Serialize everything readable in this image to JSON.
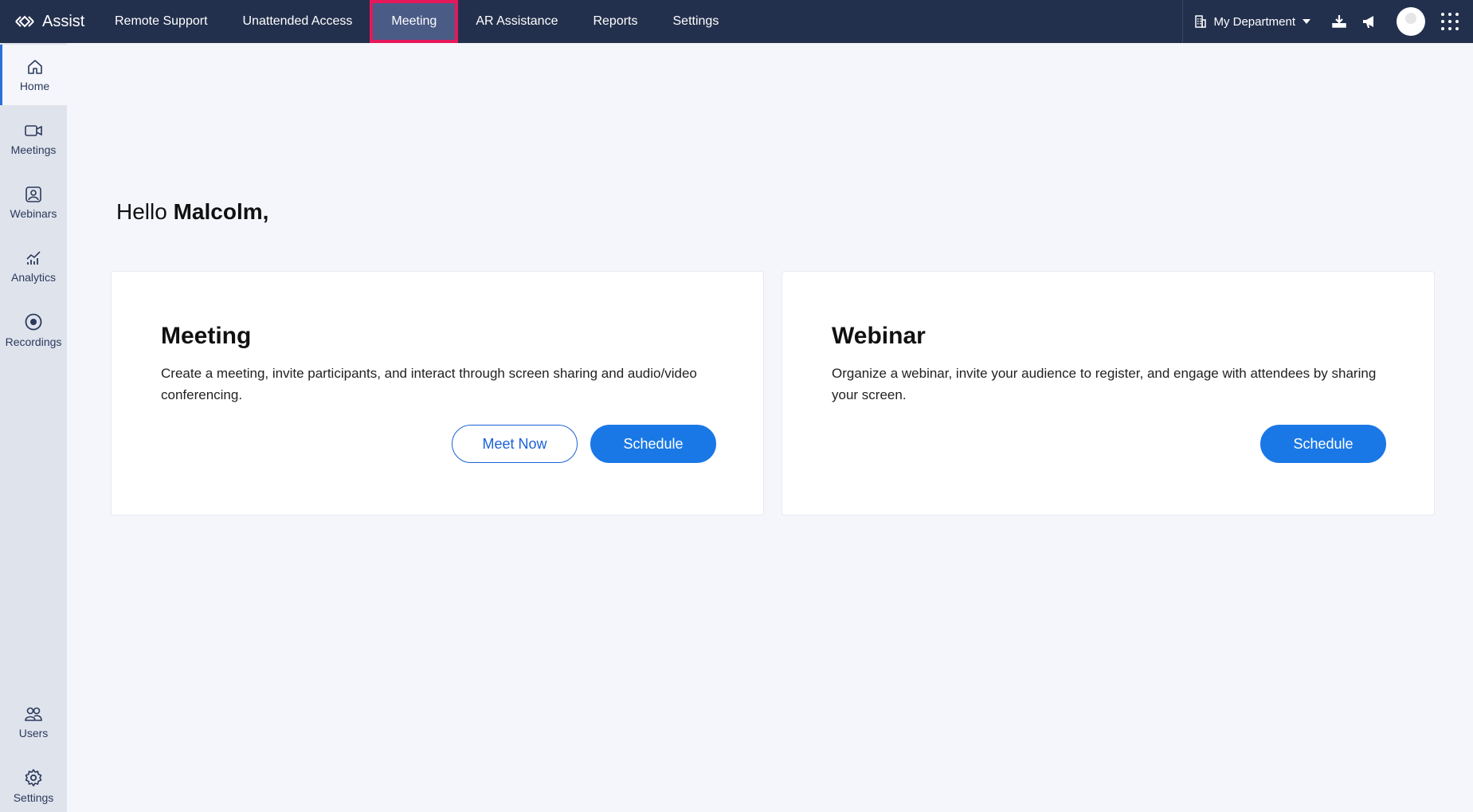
{
  "app": {
    "brand": "Assist"
  },
  "nav": {
    "items": [
      {
        "label": "Remote Support"
      },
      {
        "label": "Unattended Access"
      },
      {
        "label": "Meeting"
      },
      {
        "label": "AR Assistance"
      },
      {
        "label": "Reports"
      },
      {
        "label": "Settings"
      }
    ],
    "active": "Meeting"
  },
  "topright": {
    "department": "My Department"
  },
  "sidebar": {
    "items": [
      {
        "label": "Home",
        "icon": "home-icon"
      },
      {
        "label": "Meetings",
        "icon": "video-icon"
      },
      {
        "label": "Webinars",
        "icon": "webinar-icon"
      },
      {
        "label": "Analytics",
        "icon": "analytics-icon"
      },
      {
        "label": "Recordings",
        "icon": "record-icon"
      },
      {
        "label": "Users",
        "icon": "users-icon"
      },
      {
        "label": "Settings",
        "icon": "gear-icon"
      }
    ]
  },
  "main": {
    "greeting_prefix": "Hello ",
    "user_name": "Malcolm,",
    "meeting_card": {
      "title": "Meeting",
      "description": "Create a meeting, invite participants, and interact through screen sharing and audio/video conferencing.",
      "meet_now": "Meet Now",
      "schedule": "Schedule"
    },
    "webinar_card": {
      "title": "Webinar",
      "description": "Organize a webinar, invite your audience to register, and engage with attendees by sharing your screen.",
      "schedule": "Schedule"
    }
  },
  "colors": {
    "topbar": "#23304d",
    "active_nav": "#4a5b86",
    "highlight": "#e5185a",
    "primary": "#1a78e6"
  }
}
